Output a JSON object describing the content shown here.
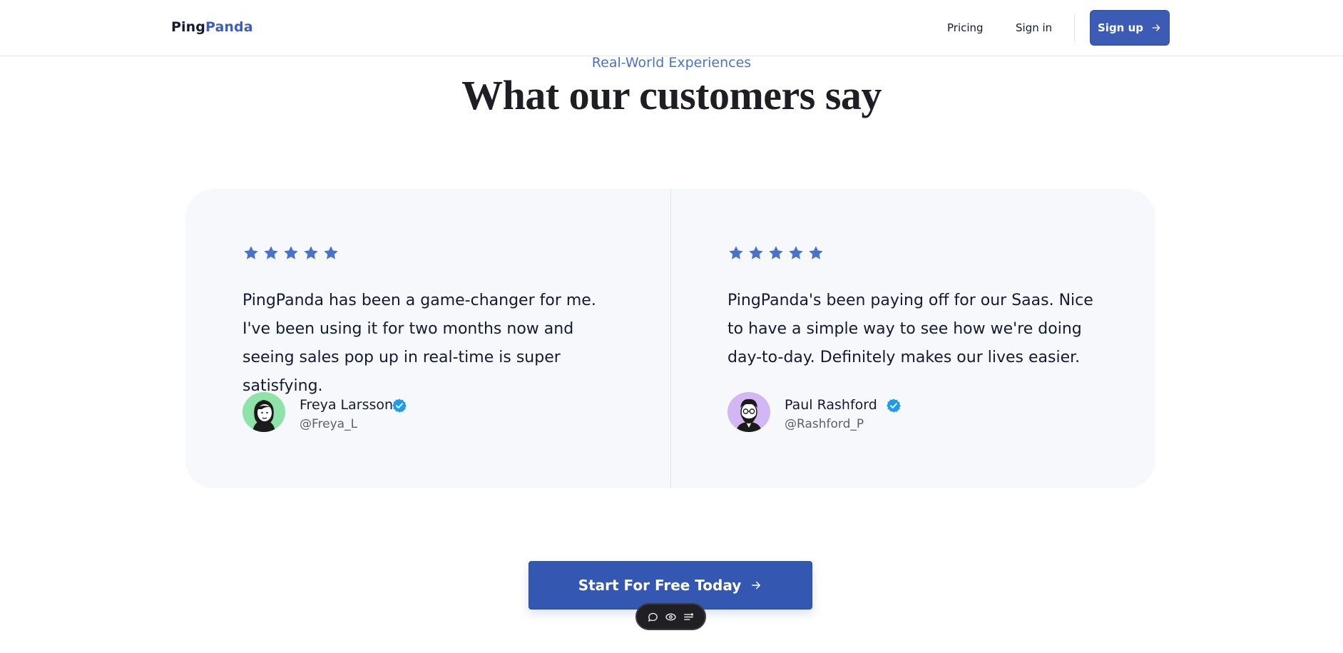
{
  "header": {
    "logo_part1": "Ping",
    "logo_part2": "Panda",
    "nav": {
      "pricing": "Pricing",
      "sign_in": "Sign in",
      "sign_up": "Sign up"
    }
  },
  "section": {
    "eyebrow": "Real-World Experiences",
    "title": "What our customers say"
  },
  "testimonials": [
    {
      "rating": 5,
      "quote": "PingPanda has been a game-changer for me. I've been using it for two months now and seeing sales pop up in real-time is super satisfying.",
      "name": "Freya Larsson",
      "handle": "@Freya_L",
      "verified": true,
      "avatar_bg": "#8ee3a9"
    },
    {
      "rating": 5,
      "quote": "PingPanda's been paying off for our Saas. Nice to have a simple way to see how we're doing day-to-day. Definitely makes our lives easier.",
      "name": "Paul Rashford",
      "handle": "@Rashford_P",
      "verified": true,
      "avatar_bg": "#d3b6f4"
    }
  ],
  "cta": {
    "label": "Start For Free Today"
  },
  "toolbar": {
    "icons": [
      "comment-icon",
      "eye-icon",
      "menu-icon"
    ]
  },
  "colors": {
    "brand": "#3b5bb5",
    "accent": "#4a72c9",
    "star": "#4a72c9",
    "verified": "#1d9bf0",
    "card_bg": "#f7f8fb"
  }
}
